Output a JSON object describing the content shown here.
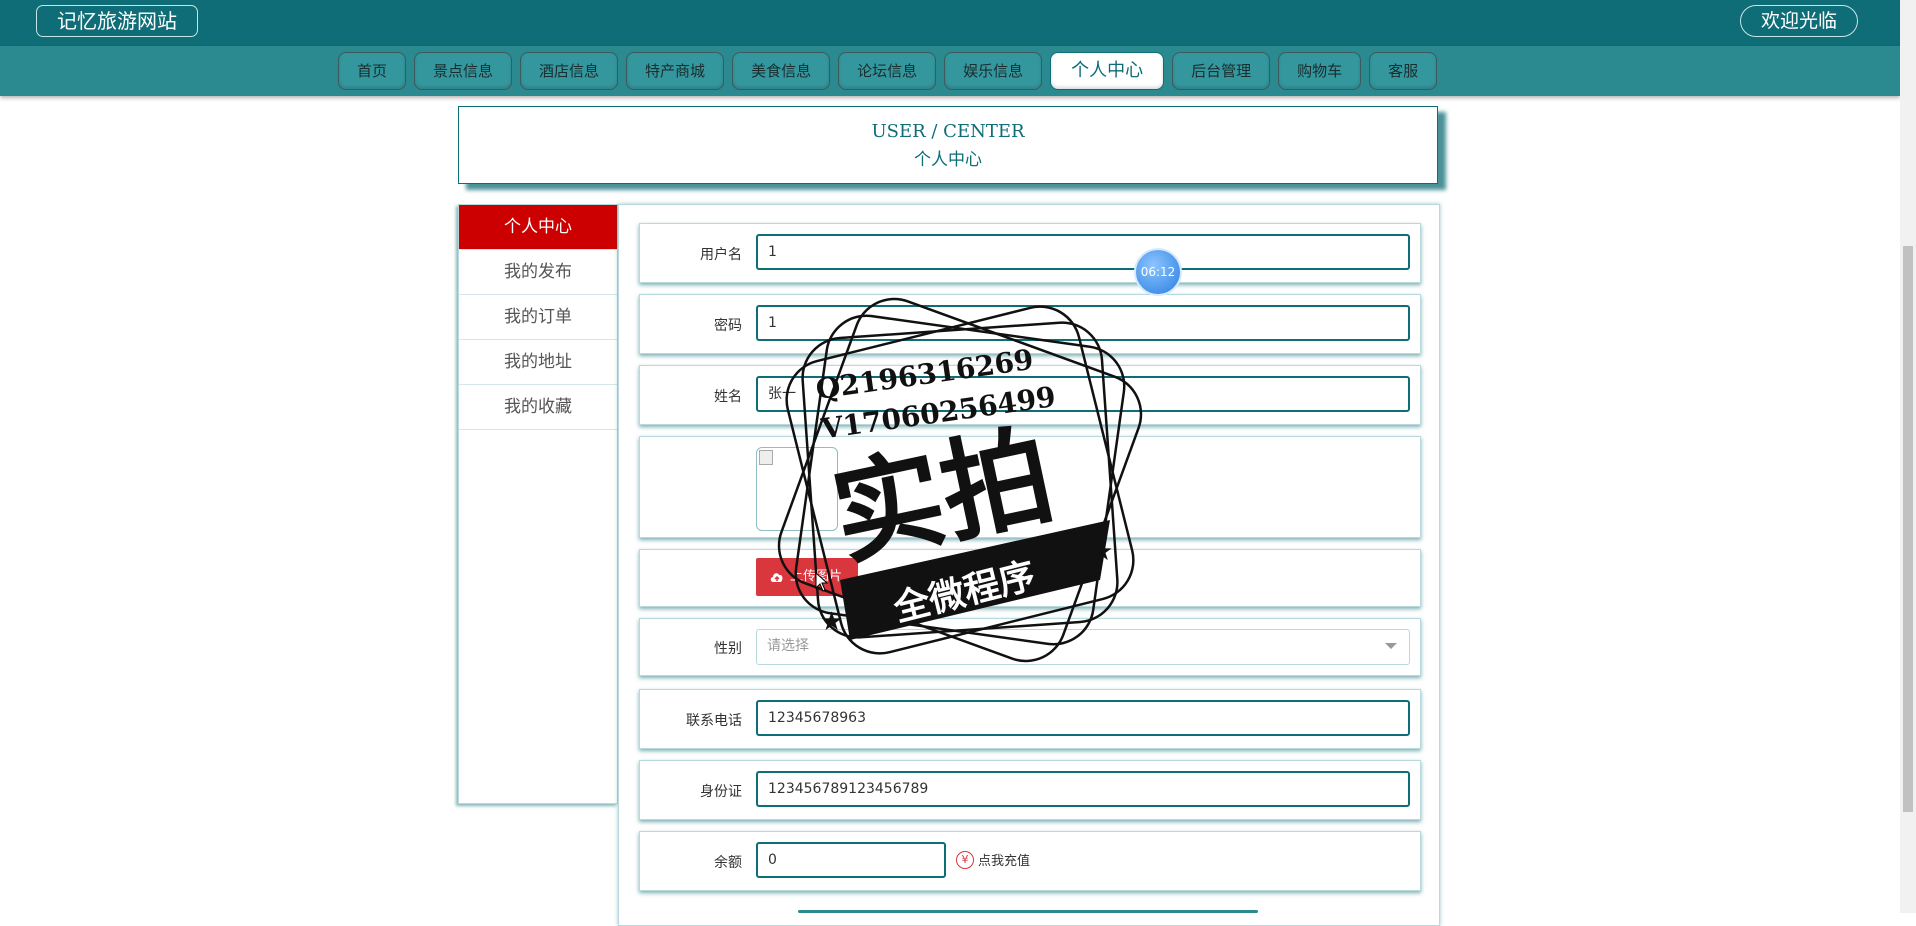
{
  "header": {
    "site_title": "记忆旅游网站",
    "welcome": "欢迎光临"
  },
  "nav": {
    "items": [
      {
        "label": "首页"
      },
      {
        "label": "景点信息"
      },
      {
        "label": "酒店信息"
      },
      {
        "label": "特产商城"
      },
      {
        "label": "美食信息"
      },
      {
        "label": "论坛信息"
      },
      {
        "label": "娱乐信息"
      },
      {
        "label": "个人中心",
        "active": true
      },
      {
        "label": "后台管理"
      },
      {
        "label": "购物车"
      },
      {
        "label": "客服"
      }
    ]
  },
  "page_heading": {
    "en": "USER / CENTER",
    "cn": "个人中心"
  },
  "sidebar": {
    "items": [
      {
        "label": "个人中心",
        "active": true
      },
      {
        "label": "我的发布"
      },
      {
        "label": "我的订单"
      },
      {
        "label": "我的地址"
      },
      {
        "label": "我的收藏"
      }
    ]
  },
  "form": {
    "username": {
      "label": "用户名",
      "value": "1"
    },
    "password": {
      "label": "密码",
      "value": "1"
    },
    "name": {
      "label": "姓名",
      "value": "张一"
    },
    "upload_label": "上传图片",
    "gender": {
      "label": "性别",
      "placeholder": "请选择"
    },
    "phone": {
      "label": "联系电话",
      "value": "12345678963"
    },
    "id_card": {
      "label": "身份证",
      "value": "123456789123456789"
    },
    "balance": {
      "label": "余额",
      "value": "0"
    },
    "recharge_label": "点我充值",
    "recharge_symbol": "¥"
  },
  "timer": "06:12",
  "watermark": {
    "line1": "Q2196316269",
    "line2": "V17060256499",
    "main": "实拍",
    "banner": "全微程序"
  },
  "colors": {
    "primary": "#0e6d76",
    "nav_bg": "#2a8a90",
    "accent_red": "#cc0000"
  }
}
